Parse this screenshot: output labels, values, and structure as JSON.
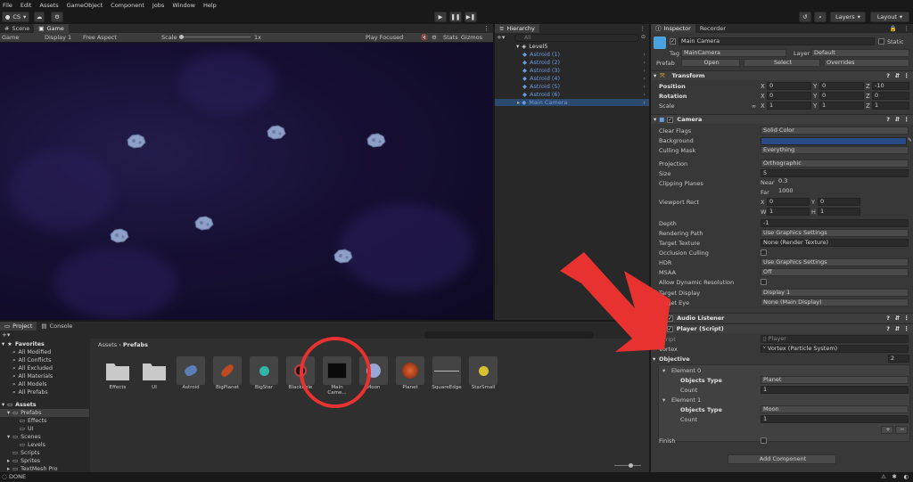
{
  "menubar": [
    "File",
    "Edit",
    "Assets",
    "GameObject",
    "Component",
    "Jobs",
    "Window",
    "Help"
  ],
  "toolbar": {
    "account": "CS",
    "layers": "Layers",
    "layout": "Layout"
  },
  "scene_tabs": {
    "scene": "Scene",
    "game": "Game"
  },
  "gamebar": {
    "display": "Game",
    "display_num": "Display 1",
    "aspect": "Free Aspect",
    "scale_label": "Scale",
    "scale_value": "1x",
    "play_mode": "Play Focused",
    "stats": "Stats",
    "gizmos": "Gizmos"
  },
  "hierarchy": {
    "tab": "Hierarchy",
    "search_placeholder": "All",
    "scene": "Level5",
    "items": [
      "Astroid (1)",
      "Astroid (2)",
      "Astroid (3)",
      "Astroid (4)",
      "Astroid (5)",
      "Astroid (6)",
      "Main Camera"
    ]
  },
  "inspector": {
    "tabs": [
      "Inspector",
      "Recorder"
    ],
    "object_name": "Main Camera",
    "static_label": "Static",
    "tag_label": "Tag",
    "tag": "MainCamera",
    "layer_label": "Layer",
    "layer": "Default",
    "prefab_label": "Prefab",
    "open": "Open",
    "select": "Select",
    "overrides": "Overrides",
    "transform": {
      "title": "Transform",
      "position_label": "Position",
      "rotation_label": "Rotation",
      "scale_label": "Scale",
      "position": [
        "0",
        "0",
        "-10"
      ],
      "rotation": [
        "0",
        "0",
        "0"
      ],
      "scale": [
        "1",
        "1",
        "1"
      ],
      "axes": [
        "X",
        "Y",
        "Z"
      ]
    },
    "camera": {
      "title": "Camera",
      "rows": [
        {
          "label": "Clear Flags",
          "value": "Solid Color"
        },
        {
          "label": "Background",
          "value": ""
        },
        {
          "label": "Culling Mask",
          "value": "Everything"
        },
        {
          "label": "Projection",
          "value": "Orthographic"
        },
        {
          "label": "Size",
          "value": "5"
        },
        {
          "label": "Clipping Planes",
          "value": ""
        },
        {
          "label": "Viewport Rect",
          "value": ""
        },
        {
          "label": "Depth",
          "value": "-1"
        },
        {
          "label": "Rendering Path",
          "value": "Use Graphics Settings"
        },
        {
          "label": "Target Texture",
          "value": "None (Render Texture)"
        },
        {
          "label": "Occlusion Culling",
          "value": ""
        },
        {
          "label": "HDR",
          "value": "Use Graphics Settings"
        },
        {
          "label": "MSAA",
          "value": "Off"
        },
        {
          "label": "Allow Dynamic Resolution",
          "value": ""
        },
        {
          "label": "Target Display",
          "value": "Display 1"
        },
        {
          "label": "Target Eye",
          "value": "None (Main Display)"
        }
      ],
      "near_label": "Near",
      "near": "0.3",
      "far_label": "Far",
      "far": "1000",
      "vp": {
        "x_label": "X",
        "x": "0",
        "y_label": "Y",
        "y": "0",
        "w_label": "W",
        "w": "1",
        "h_label": "H",
        "h": "1"
      },
      "background_color": "#2a4a86"
    },
    "audio_listener": "Audio Listener",
    "player_script": {
      "title": "Player (Script)",
      "script_label": "Script",
      "script": "Player",
      "vortex_label": "Vortex",
      "vortex": "Vortex (Particle System)",
      "objective_label": "Objective",
      "objective_count": "2",
      "elements": [
        {
          "title": "Element 0",
          "type_label": "Objects Type",
          "type": "Planet",
          "count_label": "Count",
          "count": "1"
        },
        {
          "title": "Element 1",
          "type_label": "Objects Type",
          "type": "Moon",
          "count_label": "Count",
          "count": "1"
        }
      ],
      "finish_label": "Finish"
    },
    "add_component": "Add Component"
  },
  "project": {
    "tabs": [
      "Project",
      "Console"
    ],
    "breadcrumb": [
      "Assets",
      "Prefabs"
    ],
    "count": "23",
    "favorites_title": "Favorites",
    "favorites": [
      "All Modified",
      "All Conflicts",
      "All Excluded",
      "All Materials",
      "All Models",
      "All Prefabs"
    ],
    "assets_title": "Assets",
    "tree": [
      "Prefabs",
      "Effects",
      "UI",
      "Scenes",
      "Levels",
      "Scripts",
      "Sprites",
      "TextMesh Pro"
    ],
    "items": [
      "Effects",
      "UI",
      "Astroid",
      "BigPlanet",
      "BigStar",
      "Blackhole",
      "Main Came...",
      "Moon",
      "Planet",
      "SquareEdge",
      "StarSmall"
    ]
  },
  "status": {
    "text": "DONE"
  },
  "colors": {
    "annotation_red": "#e8322f",
    "link_blue": "#6a9ce0"
  }
}
